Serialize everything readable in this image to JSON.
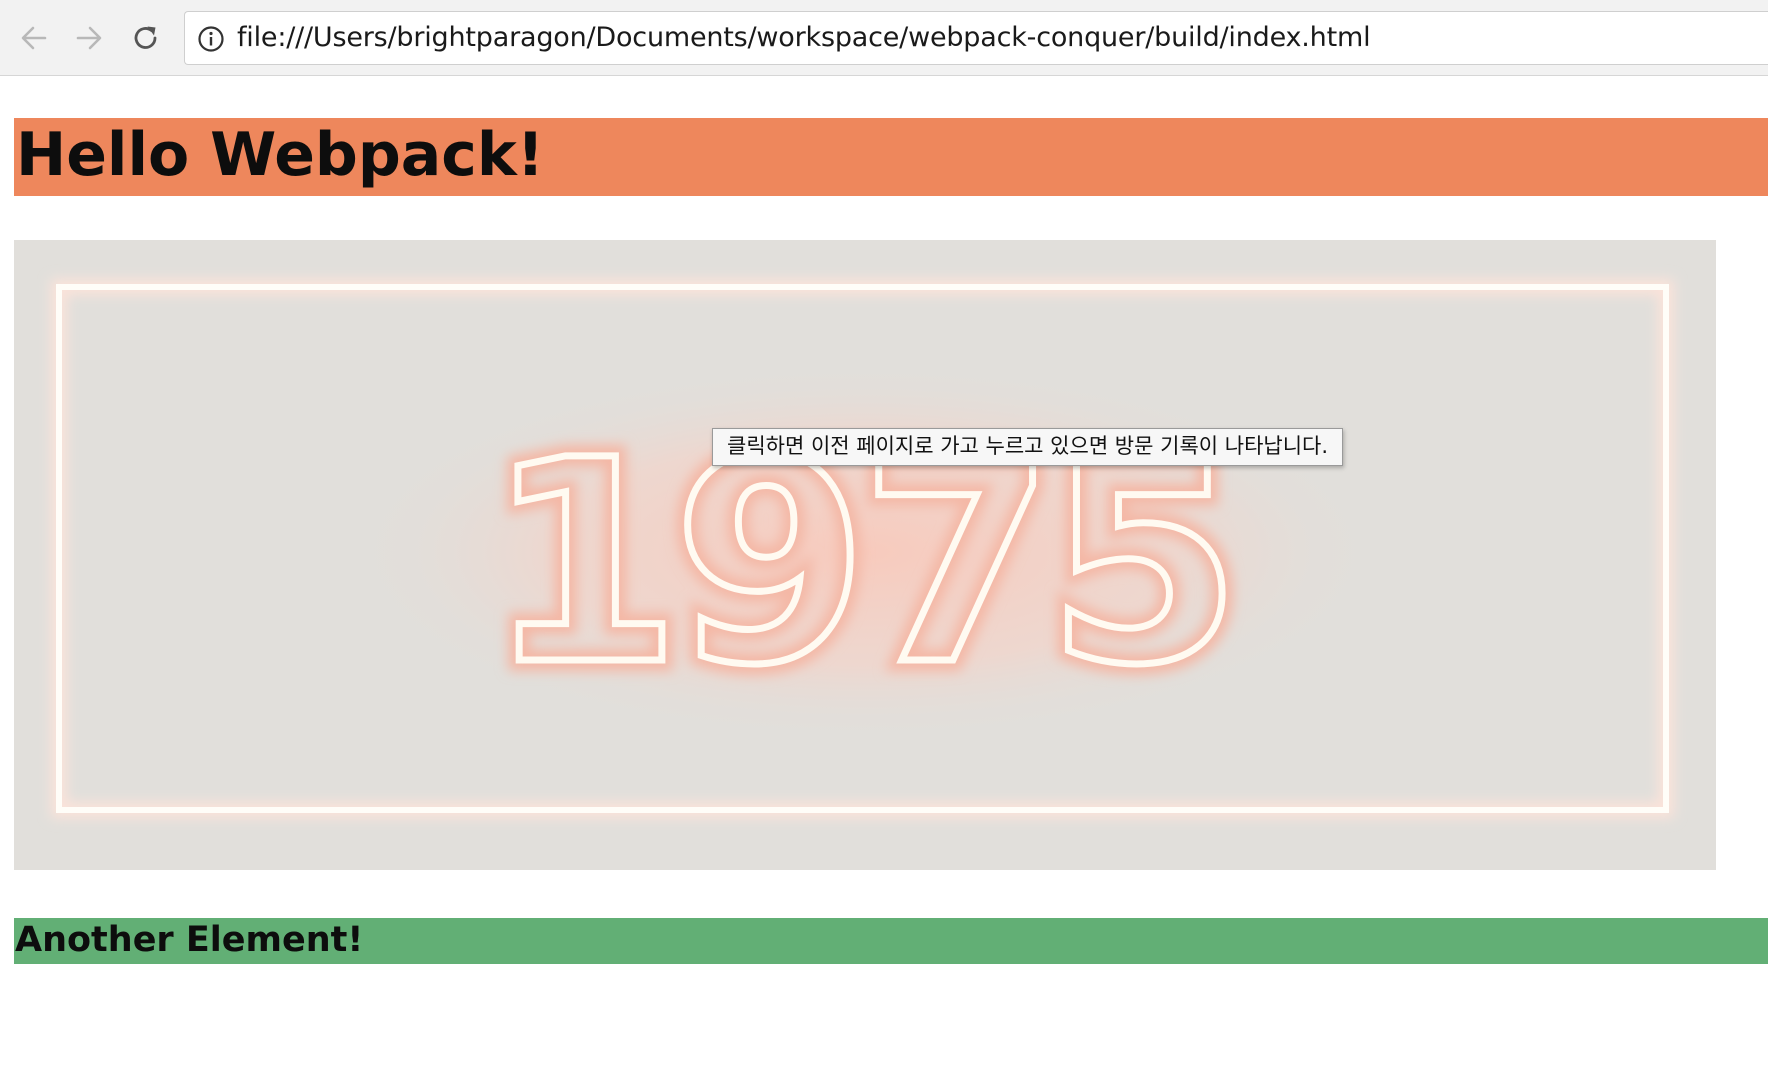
{
  "browser": {
    "url": "file:///Users/brightparagon/Documents/workspace/webpack-conquer/build/index.html",
    "icons": {
      "back": "arrow-left-icon",
      "forward": "arrow-right-icon",
      "reload": "reload-icon",
      "site_info": "info-icon"
    }
  },
  "page": {
    "heading": "Hello Webpack!",
    "image_text": "1975",
    "sub_heading": "Another Element!"
  },
  "tooltip": {
    "text": "클릭하면 이전 페이지로 가고 누르고 있으면 방문 기록이 나타납니다."
  },
  "colors": {
    "heading_bg": "#ee875c",
    "sub_heading_bg": "#62af75",
    "image_bg": "#e1dfdb",
    "neon_glow": "#f7c6b8"
  }
}
